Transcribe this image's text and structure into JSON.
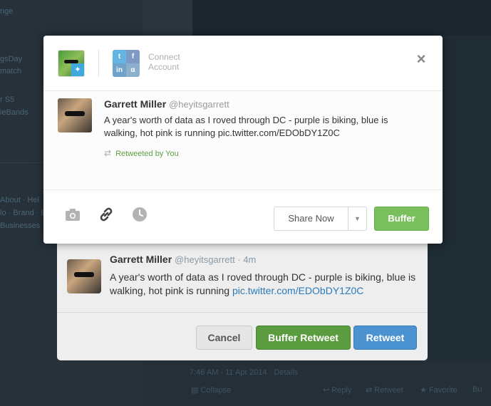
{
  "background": {
    "left_items": [
      "nge",
      "gsDay",
      "match",
      "r S5",
      "ieBands"
    ],
    "footer_links": [
      "About · Hel",
      "lo · Brand · B",
      "Businesses"
    ],
    "timestamp": "7:46 AM - 11 Apr 2014 · Details",
    "actions": {
      "collapse": "Collapse",
      "reply": "Reply",
      "retweet": "Retweet",
      "favorite": "Favorite",
      "more": "Bu"
    }
  },
  "buffer_modal": {
    "connect_label_line1": "Connect",
    "connect_label_line2": "Account",
    "connect_icons": [
      "t",
      "f",
      "in",
      "α"
    ],
    "close_symbol": "×",
    "tweet": {
      "name": "Garrett Miller",
      "handle": "@heyitsgarrett",
      "text": "A year's worth of data as I roved through DC - purple is biking, blue is walking, hot pink is running pic.twitter.com/EDObDY1Z0C",
      "retweeted_label": "Retweeted by You",
      "retweet_icon": "⇄"
    },
    "share_now_label": "Share Now",
    "caret_symbol": "▼",
    "buffer_label": "Buffer",
    "colors": {
      "buffer_green": "#79c05d",
      "retweeted_green": "#5b9f42"
    }
  },
  "retweet_dialog": {
    "tweet": {
      "name": "Garrett Miller",
      "handle": "@heyitsgarrett · 4m",
      "text_before_link": "A year's worth of data as I roved through DC - purple is biking, blue is walking, hot pink is running ",
      "link": "pic.twitter.com/EDObDY1Z0C"
    },
    "cancel_label": "Cancel",
    "buffer_retweet_label": "Buffer Retweet",
    "retweet_label": "Retweet",
    "colors": {
      "buffer_retweet": "#5a9c3f",
      "retweet": "#4a93d0",
      "link": "#2b7bb9"
    }
  }
}
